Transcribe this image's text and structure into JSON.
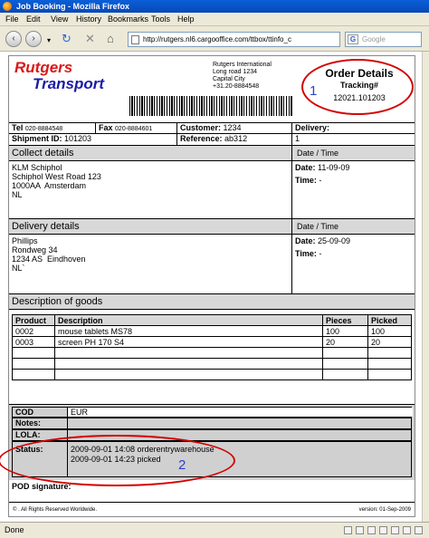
{
  "window": {
    "title": "Job Booking - Mozilla Firefox"
  },
  "menu": [
    "File",
    "Edit",
    "View",
    "History",
    "Bookmarks",
    "Tools",
    "Help"
  ],
  "nav": {
    "url": "http://rutgers.nl6.cargooffice.com/ttbox/ttinfo_c",
    "search_placeholder": "Google"
  },
  "header": {
    "logo_line1": "Rutgers",
    "logo_line2": "Transport",
    "address": "Rutgers International\nLong road 1234\nCapital City\n+31.20-8884548",
    "order_title": "Order Details",
    "tracking_label": "Tracking#",
    "tracking_number": "12021.101203",
    "annotation_1": "1"
  },
  "info": {
    "tel_label": "Tel",
    "tel_value": "020-8884548",
    "fax_label": "Fax",
    "fax_value": "020-8884601",
    "customer_label": "Customer:",
    "customer_value": "1234",
    "delivery_label": "Delivery:",
    "delivery_value": "",
    "shipment_label": "Shipment ID:",
    "shipment_value": "101203",
    "reference_label": "Reference:",
    "reference_value": "ab312",
    "delivery_count": "1"
  },
  "collect": {
    "heading": "Collect details",
    "dt_heading": "Date / Time",
    "address": "KLM Schiphol\nSchiphol West Road 123\n1000AA  Amsterdam\nNL",
    "date_label": "Date:",
    "date_value": "11-09-09",
    "time_label": "Time:",
    "time_value": "-"
  },
  "delivery": {
    "heading": "Delivery details",
    "dt_heading": "Date / Time",
    "address": "Phillips\nRondweg 34\n1234 AS  Eindhoven\nNL`",
    "date_label": "Date:",
    "date_value": "25-09-09",
    "time_label": "Time:",
    "time_value": "-"
  },
  "goods": {
    "heading": "Description of goods",
    "columns": [
      "Product",
      "Description",
      "Pieces",
      "Picked"
    ],
    "rows": [
      [
        "0002",
        "mouse tablets MS78",
        "100",
        "100"
      ],
      [
        "0003",
        "screen PH 170 S4",
        "20",
        "20"
      ],
      [
        "",
        "",
        "",
        ""
      ],
      [
        "",
        "",
        "",
        ""
      ],
      [
        "",
        "",
        "",
        ""
      ]
    ]
  },
  "extra": {
    "cod_label": "COD",
    "cod_value": "EUR",
    "notes_label": "Notes:",
    "notes_value": "",
    "lola_label": "LOLA:",
    "lola_value": "",
    "status_label": "Status:",
    "status_line1": "2009-09-01 14:08 orderentrywarehouse",
    "status_line2": "2009-09-01 14:23 picked",
    "annotation_2": "2",
    "pod_label": "POD signature:"
  },
  "footer": {
    "rights": "© . All Rights Reserved Worldwide.",
    "version": "version: 01-Sep-2009"
  },
  "status": {
    "text": "Done"
  },
  "colors": {
    "logo_red": "#d81818",
    "logo_blue": "#1a1aa8",
    "annotation_red": "#d40000",
    "annotation_blue": "#2a43c9"
  }
}
